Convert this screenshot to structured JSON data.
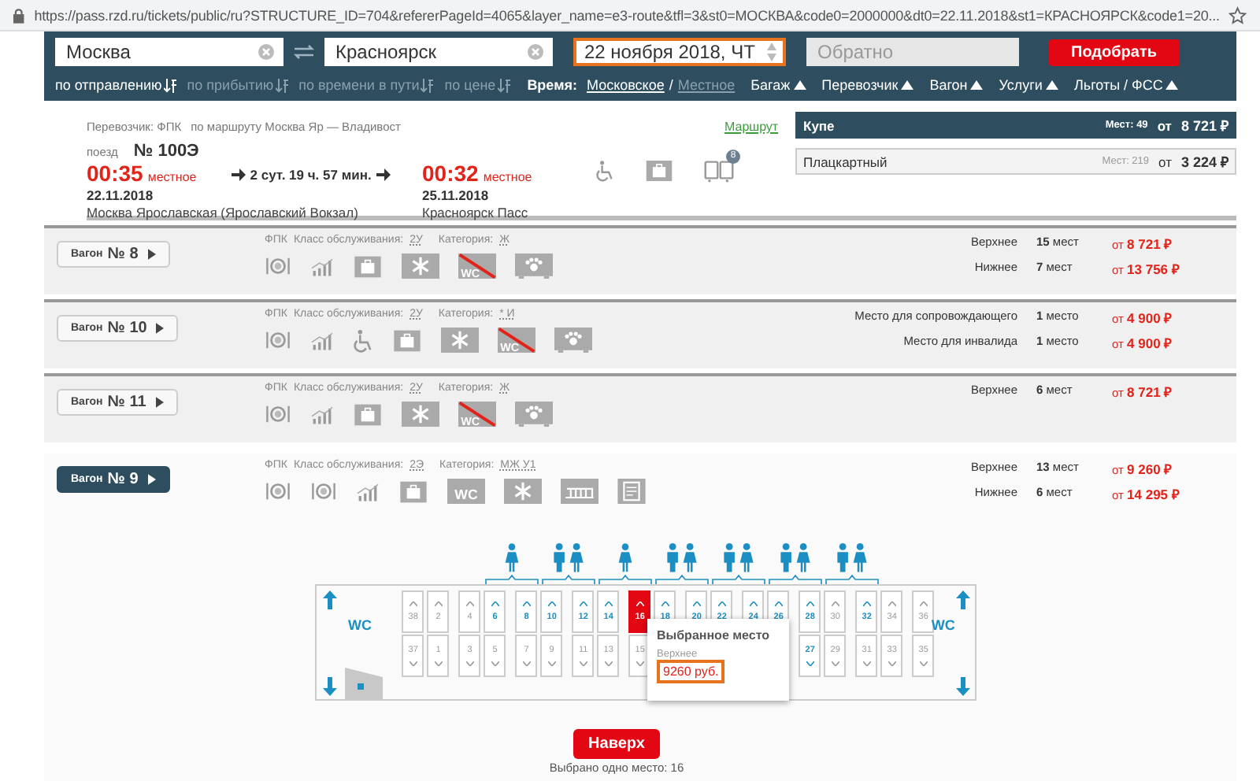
{
  "browser": {
    "url": "https://pass.rzd.ru/tickets/public/ru?STRUCTURE_ID=704&refererPageId=4065&layer_name=e3-route&tfl=3&st0=МОСКВА&code0=2000000&dt0=22.11.2018&st1=КРАСНОЯРСК&code1=20..."
  },
  "search": {
    "from": "Москва",
    "to": "Красноярск",
    "date": "22 ноября 2018, ЧТ",
    "date_highlighted": true,
    "return_placeholder": "Обратно",
    "submit": "Подобрать"
  },
  "sort": {
    "options": [
      {
        "label": "по отправлению",
        "selected": true
      },
      {
        "label": "по прибытию",
        "selected": false
      },
      {
        "label": "по времени в пути",
        "selected": false
      },
      {
        "label": "по цене",
        "selected": false
      }
    ],
    "time_label": "Время:",
    "time_zones": [
      {
        "label": "Московское",
        "selected": true
      },
      {
        "label": "Местное",
        "selected": false
      }
    ],
    "time_separator": "/",
    "filters": [
      "Багаж",
      "Перевозчик",
      "Вагон",
      "Услуги",
      "Льготы / ФСС"
    ]
  },
  "train": {
    "carrier": "Перевозчик: ФПК",
    "route": "по маршруту Москва Яр — Владивост",
    "route_link": "Маршрут",
    "train_label": "поезд",
    "number": "№ 100Э",
    "departure": {
      "time": "00:35",
      "zone": "местное",
      "date": "22.11.2018",
      "station": "Москва Ярославская (Ярославский Вокзал)"
    },
    "duration": "2 сут. 19 ч. 57 мин.",
    "arrival": {
      "time": "00:32",
      "zone": "местное",
      "date": "25.11.2018",
      "station": "Красноярск Пасс"
    },
    "wagon_badge": "8"
  },
  "classes": [
    {
      "name": "Купе",
      "seats": "Мест: 49",
      "from": "от",
      "price": "8 721 ₽",
      "selected": true
    },
    {
      "name": "Плацкартный",
      "seats": "Мест: 219",
      "from": "от",
      "price": "3 224 ₽",
      "selected": false
    }
  ],
  "wagons": [
    {
      "label": "Вагон",
      "number": "№ 8",
      "selected": false,
      "carrier": "ФПК",
      "class_label": "Класс обслуживания:",
      "class": "2У",
      "category_label": "Категория:",
      "category": "Ж",
      "amenities": [
        {
          "kind": "meal"
        },
        {
          "kind": "stats"
        },
        {
          "kind": "luggage"
        },
        {
          "kind": "ac"
        },
        {
          "kind": "no-wc",
          "label": "WC"
        },
        {
          "kind": "pets"
        }
      ],
      "seats": [
        {
          "type": "Верхнее",
          "count": "15",
          "unit": "мест",
          "from": "от",
          "price": "8 721 ₽"
        },
        {
          "type": "Нижнее",
          "count": "7",
          "unit": "мест",
          "from": "от",
          "price": "13 756 ₽"
        }
      ]
    },
    {
      "label": "Вагон",
      "number": "№ 10",
      "selected": false,
      "carrier": "ФПК",
      "class_label": "Класс обслуживания:",
      "class": "2У",
      "category_label": "Категория:",
      "category": "* И",
      "amenities": [
        {
          "kind": "meal"
        },
        {
          "kind": "stats"
        },
        {
          "kind": "wheelchair"
        },
        {
          "kind": "luggage"
        },
        {
          "kind": "ac"
        },
        {
          "kind": "no-wc",
          "label": "WC"
        },
        {
          "kind": "pets"
        }
      ],
      "seats": [
        {
          "type": "Место для сопровождающего",
          "count": "1",
          "unit": "место",
          "from": "от",
          "price": "4 900 ₽"
        },
        {
          "type": "Место для инвалида",
          "count": "1",
          "unit": "место",
          "from": "от",
          "price": "4 900 ₽"
        }
      ]
    },
    {
      "label": "Вагон",
      "number": "№ 11",
      "selected": false,
      "carrier": "ФПК",
      "class_label": "Класс обслуживания:",
      "class": "2У",
      "category_label": "Категория:",
      "category": "Ж",
      "amenities": [
        {
          "kind": "meal"
        },
        {
          "kind": "stats"
        },
        {
          "kind": "luggage"
        },
        {
          "kind": "ac"
        },
        {
          "kind": "no-wc",
          "label": "WC"
        },
        {
          "kind": "pets"
        }
      ],
      "seats": [
        {
          "type": "Верхнее",
          "count": "6",
          "unit": "мест",
          "from": "от",
          "price": "8 721 ₽"
        }
      ]
    },
    {
      "label": "Вагон",
      "number": "№ 9",
      "selected": true,
      "carrier": "ФПК",
      "class_label": "Класс обслуживания:",
      "class": "2Э",
      "category_label": "Категория:",
      "category": "МЖ У1",
      "amenities": [
        {
          "kind": "meal"
        },
        {
          "kind": "meal"
        },
        {
          "kind": "stats"
        },
        {
          "kind": "luggage"
        },
        {
          "kind": "wc",
          "label": "WC"
        },
        {
          "kind": "ac"
        },
        {
          "kind": "linen"
        },
        {
          "kind": "docs"
        }
      ],
      "seats": [
        {
          "type": "Верхнее",
          "count": "13",
          "unit": "мест",
          "from": "от",
          "price": "9 260 ₽"
        },
        {
          "type": "Нижнее",
          "count": "6",
          "unit": "мест",
          "from": "от",
          "price": "14 295 ₽"
        }
      ]
    }
  ],
  "seat_map": {
    "wc_left": "WC",
    "wc_right": "WC",
    "groups": [
      {
        "kind": "single"
      },
      {
        "kind": "pair"
      },
      {
        "kind": "single"
      },
      {
        "kind": "pair"
      },
      {
        "kind": "pair"
      },
      {
        "kind": "pair"
      },
      {
        "kind": "pair"
      }
    ],
    "columns": [
      {
        "top": {
          "number": "38",
          "available": false,
          "selected": false
        },
        "bottom": {
          "number": "37",
          "available": false,
          "selected": false
        }
      },
      {
        "top": {
          "number": "2",
          "available": false,
          "selected": false
        },
        "bottom": {
          "number": "1",
          "available": false,
          "selected": false
        }
      },
      {
        "top": {
          "number": "4",
          "available": false,
          "selected": false
        },
        "bottom": {
          "number": "3",
          "available": false,
          "selected": false
        }
      },
      {
        "top": {
          "number": "6",
          "available": true,
          "selected": false
        },
        "bottom": {
          "number": "5",
          "available": false,
          "selected": false
        }
      },
      {
        "top": {
          "number": "8",
          "available": true,
          "selected": false
        },
        "bottom": {
          "number": "7",
          "available": false,
          "selected": false
        }
      },
      {
        "top": {
          "number": "10",
          "available": true,
          "selected": false
        },
        "bottom": {
          "number": "9",
          "available": false,
          "selected": false
        }
      },
      {
        "top": {
          "number": "12",
          "available": true,
          "selected": false
        },
        "bottom": {
          "number": "11",
          "available": false,
          "selected": false
        }
      },
      {
        "top": {
          "number": "14",
          "available": true,
          "selected": false
        },
        "bottom": {
          "number": "13",
          "available": false,
          "selected": false
        }
      },
      {
        "top": {
          "number": "16",
          "available": false,
          "selected": true
        },
        "bottom": {
          "number": "15",
          "available": false,
          "selected": false
        }
      },
      {
        "top": {
          "number": "18",
          "available": true,
          "selected": false
        }
      },
      {
        "top": {
          "number": "20",
          "available": true,
          "selected": false
        }
      },
      {
        "top": {
          "number": "22",
          "available": true,
          "selected": false
        }
      },
      {
        "top": {
          "number": "24",
          "available": true,
          "selected": false
        }
      },
      {
        "top": {
          "number": "26",
          "available": true,
          "selected": false
        }
      },
      {
        "top": {
          "number": "28",
          "available": true,
          "selected": false
        },
        "bottom": {
          "number": "27",
          "available": true,
          "selected": false
        }
      },
      {
        "top": {
          "number": "30",
          "available": false,
          "selected": false
        },
        "bottom": {
          "number": "29",
          "available": false,
          "selected": false
        }
      },
      {
        "top": {
          "number": "32",
          "available": true,
          "selected": false
        },
        "bottom": {
          "number": "31",
          "available": false,
          "selected": false
        }
      },
      {
        "top": {
          "number": "34",
          "available": false,
          "selected": false
        },
        "bottom": {
          "number": "33",
          "available": false,
          "selected": false
        }
      },
      {
        "top": {
          "number": "36",
          "available": false,
          "selected": false
        },
        "bottom": {
          "number": "35",
          "available": false,
          "selected": false
        }
      }
    ],
    "popup": {
      "title": "Выбранное место",
      "seat_type": "Верхнее",
      "price": "9260 руб.",
      "highlighted": true
    }
  },
  "footer": {
    "button": "Наверх",
    "selection": "Выбрано одно место: 16"
  }
}
